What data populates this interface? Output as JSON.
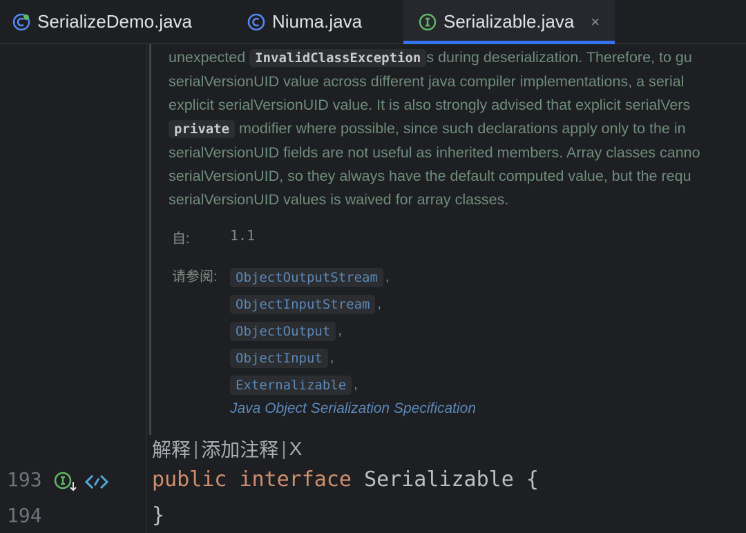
{
  "tabs": [
    {
      "label": "SerializeDemo.java",
      "icon": "class-runnable-icon"
    },
    {
      "label": "Niuma.java",
      "icon": "class-icon"
    },
    {
      "label": "Serializable.java",
      "icon": "interface-icon",
      "active": true,
      "close": "×"
    }
  ],
  "doc": {
    "line1_pre": "unexpected ",
    "line1_chip": "InvalidClassException",
    "line1_post": "s during deserialization. Therefore, to gu",
    "line2": "serialVersionUID value across different java compiler implementations, a serial",
    "line3": "explicit serialVersionUID value. It is also strongly advised that explicit serialVers",
    "line4_chip": "private",
    "line4_post": " modifier where possible, since such declarations apply only to the in",
    "line5": "serialVersionUID fields are not useful as inherited members. Array classes canno",
    "line6": "serialVersionUID, so they always have the default computed value, but the requ",
    "line7": "serialVersionUID values is waived for array classes.",
    "since_label": "自:",
    "since_value": "1.1",
    "see_label": "请参阅:",
    "see_items": [
      "ObjectOutputStream",
      "ObjectInputStream",
      "ObjectOutput",
      "ObjectInput",
      "Externalizable"
    ],
    "spec_link": "Java Object Serialization Specification"
  },
  "hints": {
    "explain": "解释",
    "add_comment": "添加注释",
    "close": "X",
    "sep": "|"
  },
  "editor": {
    "line_numbers": [
      "193",
      "194"
    ],
    "line193": {
      "kw1": "public",
      "kw2": "interface",
      "name": "Serializable",
      "brace": "{"
    },
    "line194": "}"
  }
}
